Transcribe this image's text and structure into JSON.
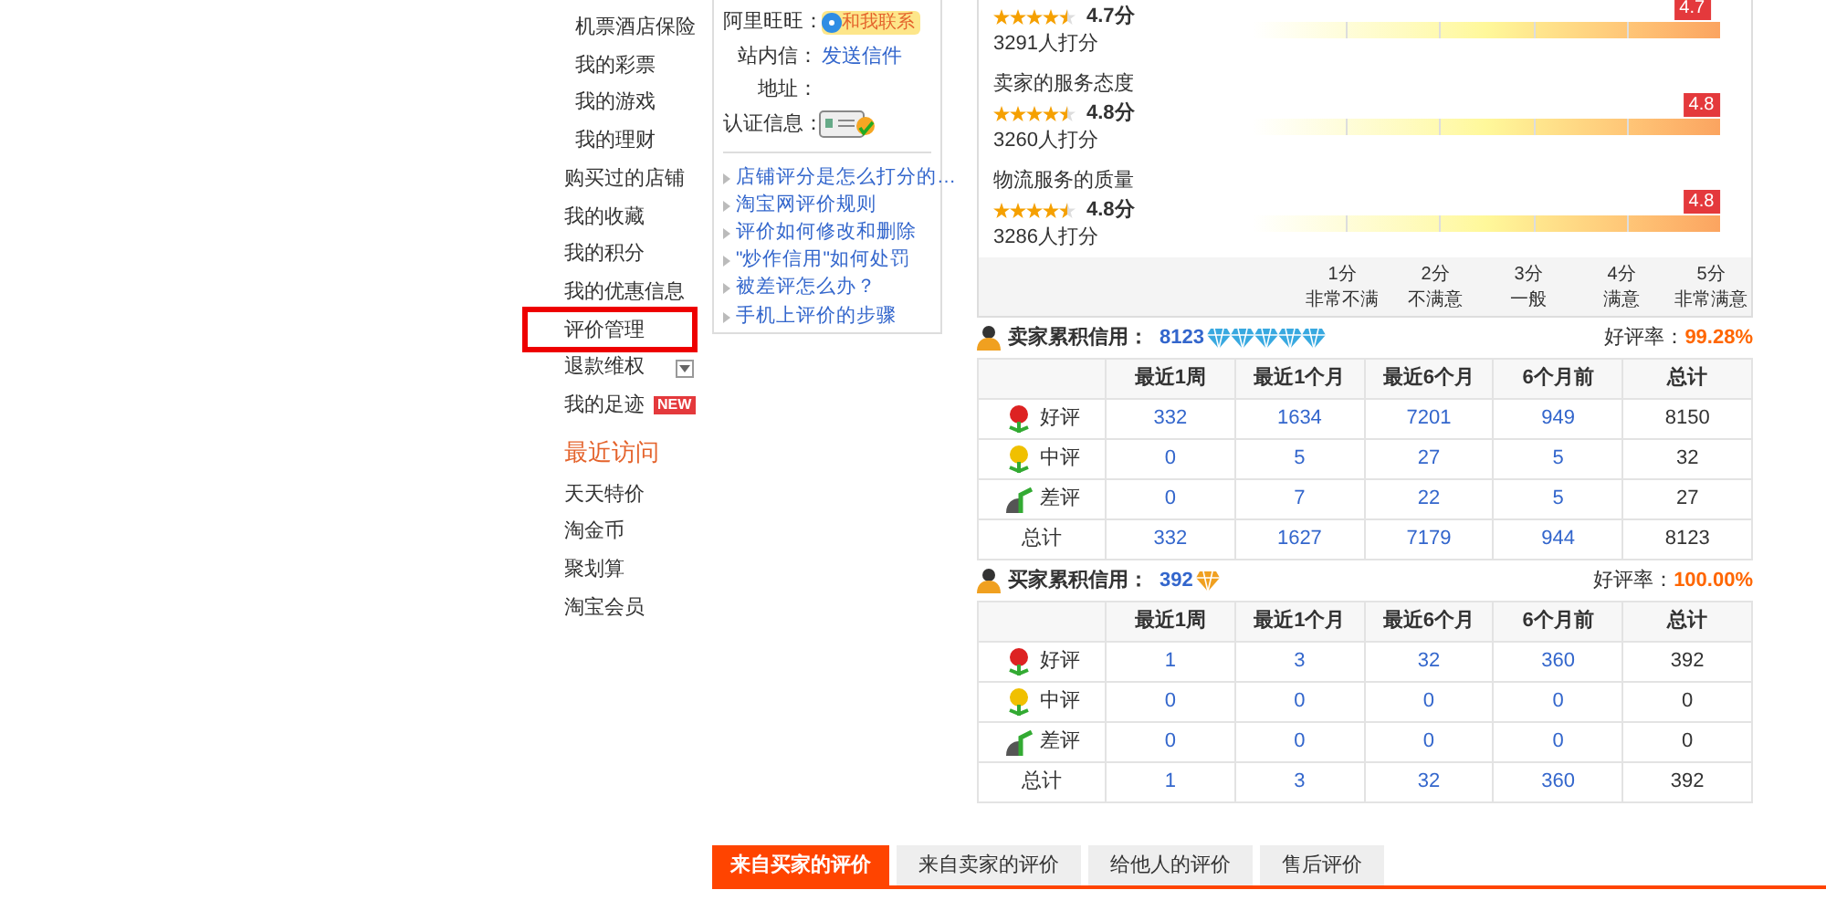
{
  "sidebar": {
    "sub_items": [
      "机票酒店保险",
      "我的彩票",
      "我的游戏",
      "我的理财"
    ],
    "items": [
      {
        "label": "购买过的店铺",
        "highlighted": false
      },
      {
        "label": "我的收藏",
        "highlighted": false
      },
      {
        "label": "我的积分",
        "highlighted": false
      },
      {
        "label": "我的优惠信息",
        "highlighted": false
      },
      {
        "label": "评价管理",
        "highlighted": true
      },
      {
        "label": "退款维权",
        "highlighted": false,
        "dropdown": true
      },
      {
        "label": "我的足迹",
        "highlighted": false,
        "badge": "NEW"
      }
    ],
    "recent_title": "最近访问",
    "recent": [
      "天天特价",
      "淘金币",
      "聚划算",
      "淘宝会员"
    ]
  },
  "seller_info": {
    "fields": [
      {
        "label": "阿里旺旺：",
        "kind": "wangwang",
        "value": "和我联系"
      },
      {
        "label": "站内信：",
        "kind": "link",
        "value": "发送信件"
      },
      {
        "label": "地址：",
        "kind": "empty"
      },
      {
        "label": "认证信息：",
        "kind": "cert"
      }
    ],
    "links": [
      "店铺评分是怎么打分的…",
      "淘宝网评价规则",
      "评价如何修改和删除",
      "\"炒作信用\"如何处罚",
      "被差评怎么办？",
      "手机上评价的步骤"
    ]
  },
  "ratings": {
    "items": [
      {
        "stars": 4.5,
        "score": "4.7分",
        "count": "3291人打分",
        "marker": "4.7",
        "level": 0.94
      },
      {
        "title": "卖家的服务态度",
        "stars": 4.5,
        "score": "4.8分",
        "count": "3260人打分",
        "marker": "4.8",
        "level": 0.96
      },
      {
        "title": "物流服务的质量",
        "stars": 4.5,
        "score": "4.8分",
        "count": "3286人打分",
        "marker": "4.8",
        "level": 0.96
      }
    ],
    "scale": [
      {
        "score": "1分",
        "label": "非常不满"
      },
      {
        "score": "2分",
        "label": "不满意"
      },
      {
        "score": "3分",
        "label": "一般"
      },
      {
        "score": "4分",
        "label": "满意"
      },
      {
        "score": "5分",
        "label": "非常满意"
      }
    ]
  },
  "credit_tables": [
    {
      "title": "卖家累积信用：",
      "value": "8123",
      "diamonds": [
        {
          "color": "#39a9e0"
        },
        {
          "color": "#39a9e0"
        },
        {
          "color": "#39a9e0"
        },
        {
          "color": "#39a9e0"
        },
        {
          "color": "#39a9e0"
        }
      ],
      "rate_label": "好评率：",
      "rate": "99.28%",
      "columns": [
        "最近1周",
        "最近1个月",
        "最近6个月",
        "6个月前",
        "总计"
      ],
      "rows": [
        {
          "kind": "good",
          "label": "好评",
          "cells": [
            "332",
            "1634",
            "7201",
            "949",
            "8150"
          ]
        },
        {
          "kind": "neutral",
          "label": "中评",
          "cells": [
            "0",
            "5",
            "27",
            "5",
            "32"
          ]
        },
        {
          "kind": "bad",
          "label": "差评",
          "cells": [
            "0",
            "7",
            "22",
            "5",
            "27"
          ]
        },
        {
          "kind": "total",
          "label": "总计",
          "cells": [
            "332",
            "1627",
            "7179",
            "944",
            "8123"
          ]
        }
      ]
    },
    {
      "title": "买家累积信用：",
      "value": "392",
      "diamonds": [
        {
          "color": "#f0a020"
        }
      ],
      "rate_label": "好评率：",
      "rate": "100.00%",
      "columns": [
        "最近1周",
        "最近1个月",
        "最近6个月",
        "6个月前",
        "总计"
      ],
      "rows": [
        {
          "kind": "good",
          "label": "好评",
          "cells": [
            "1",
            "3",
            "32",
            "360",
            "392"
          ]
        },
        {
          "kind": "neutral",
          "label": "中评",
          "cells": [
            "0",
            "0",
            "0",
            "0",
            "0"
          ]
        },
        {
          "kind": "bad",
          "label": "差评",
          "cells": [
            "0",
            "0",
            "0",
            "0",
            "0"
          ]
        },
        {
          "kind": "total",
          "label": "总计",
          "cells": [
            "1",
            "3",
            "32",
            "360",
            "392"
          ]
        }
      ]
    }
  ],
  "tabs": [
    {
      "label": "来自买家的评价",
      "selected": true
    },
    {
      "label": "来自卖家的评价",
      "selected": false
    },
    {
      "label": "给他人的评价",
      "selected": false
    },
    {
      "label": "售后评价",
      "selected": false
    }
  ]
}
